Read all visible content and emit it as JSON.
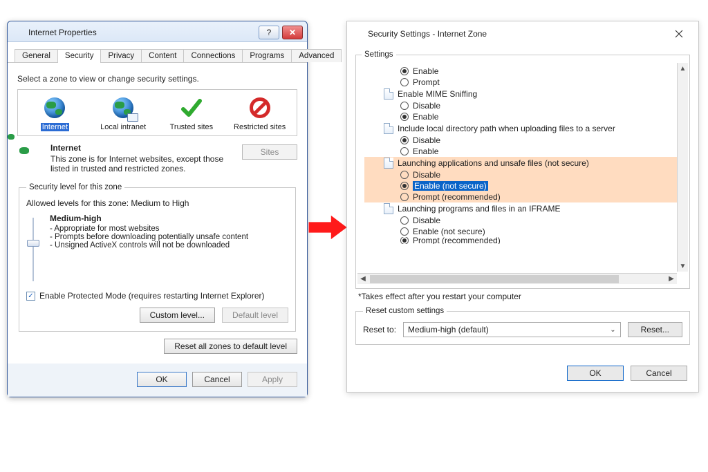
{
  "left": {
    "title": "Internet Properties",
    "tabs": [
      "General",
      "Security",
      "Privacy",
      "Content",
      "Connections",
      "Programs",
      "Advanced"
    ],
    "active_tab": "Security",
    "instruction": "Select a zone to view or change security settings.",
    "zones": [
      {
        "label": "Internet",
        "icon": "globe-icon",
        "selected": true
      },
      {
        "label": "Local intranet",
        "icon": "globe-monitor-icon",
        "selected": false
      },
      {
        "label": "Trusted sites",
        "icon": "check-icon",
        "selected": false
      },
      {
        "label": "Restricted sites",
        "icon": "ban-icon",
        "selected": false
      }
    ],
    "zone_desc": {
      "title": "Internet",
      "text": "This zone is for Internet websites, except those listed in trusted and restricted zones."
    },
    "sites_button": "Sites",
    "sec_legend": "Security level for this zone",
    "allowed": "Allowed levels for this zone: Medium to High",
    "level_name": "Medium-high",
    "bullets": [
      "- Appropriate for most websites",
      "- Prompts before downloading potentially unsafe content",
      "- Unsigned ActiveX controls will not be downloaded"
    ],
    "protected_checked": true,
    "protected_label": "Enable Protected Mode (requires restarting Internet Explorer)",
    "custom_btn": "Custom level...",
    "default_btn": "Default level",
    "reset_all_btn": "Reset all zones to default level",
    "ok": "OK",
    "cancel": "Cancel",
    "apply": "Apply"
  },
  "right": {
    "title": "Security Settings - Internet Zone",
    "settings_legend": "Settings",
    "tree": [
      {
        "type": "radio",
        "level": 2,
        "label": "Enable",
        "checked": true
      },
      {
        "type": "radio",
        "level": 2,
        "label": "Prompt",
        "checked": false
      },
      {
        "type": "group",
        "level": 1,
        "label": "Enable MIME Sniffing"
      },
      {
        "type": "radio",
        "level": 2,
        "label": "Disable",
        "checked": false
      },
      {
        "type": "radio",
        "level": 2,
        "label": "Enable",
        "checked": true
      },
      {
        "type": "group",
        "level": 1,
        "label": "Include local directory path when uploading files to a server"
      },
      {
        "type": "radio",
        "level": 2,
        "label": "Disable",
        "checked": true
      },
      {
        "type": "radio",
        "level": 2,
        "label": "Enable",
        "checked": false
      },
      {
        "type": "group",
        "level": 1,
        "label": "Launching applications and unsafe files (not secure)",
        "hl": true
      },
      {
        "type": "radio",
        "level": 2,
        "label": "Disable",
        "checked": false,
        "hl": true
      },
      {
        "type": "radio",
        "level": 2,
        "label": "Enable (not secure)",
        "checked": true,
        "hl": true,
        "selected": true
      },
      {
        "type": "radio",
        "level": 2,
        "label": "Prompt (recommended)",
        "checked": false,
        "hl": true
      },
      {
        "type": "group",
        "level": 1,
        "label": "Launching programs and files in an IFRAME"
      },
      {
        "type": "radio",
        "level": 2,
        "label": "Disable",
        "checked": false
      },
      {
        "type": "radio",
        "level": 2,
        "label": "Enable (not secure)",
        "checked": false
      },
      {
        "type": "radio",
        "level": 2,
        "label": "Prompt (recommended)",
        "checked": true,
        "cut": true
      }
    ],
    "note": "*Takes effect after you restart your computer",
    "reset_legend": "Reset custom settings",
    "reset_to_label": "Reset to:",
    "reset_value": "Medium-high (default)",
    "reset_btn": "Reset...",
    "ok": "OK",
    "cancel": "Cancel"
  }
}
